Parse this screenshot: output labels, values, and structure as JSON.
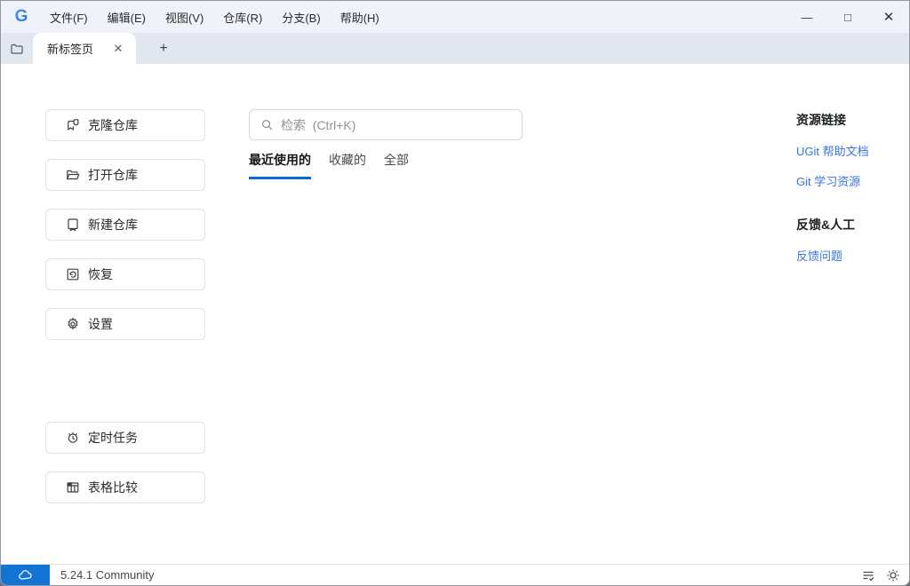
{
  "window": {
    "logo_text": "G",
    "menu_items": [
      {
        "label": "文件(F)"
      },
      {
        "label": "编辑(E)"
      },
      {
        "label": "视图(V)"
      },
      {
        "label": "仓库(R)"
      },
      {
        "label": "分支(B)"
      },
      {
        "label": "帮助(H)"
      }
    ],
    "controls": {
      "minimize": "—",
      "maximize": "□",
      "close": "✕"
    }
  },
  "tabbar": {
    "active_tab_label": "新标签页",
    "close_glyph": "✕",
    "new_tab_glyph": "+"
  },
  "sidebar": {
    "buttons": [
      {
        "label": "克隆仓库",
        "icon": "repo-clone-icon"
      },
      {
        "label": "打开仓库",
        "icon": "folder-open-icon"
      },
      {
        "label": "新建仓库",
        "icon": "repo-new-icon"
      },
      {
        "label": "恢复",
        "icon": "restore-icon"
      },
      {
        "label": "设置",
        "icon": "gear-icon"
      },
      {
        "label": "定时任务",
        "icon": "timer-task-icon"
      },
      {
        "label": "表格比较",
        "icon": "table-compare-icon"
      }
    ]
  },
  "main": {
    "search": {
      "placeholder": "检索  (Ctrl+K)"
    },
    "filter_tabs": [
      {
        "label": "最近使用的",
        "active": true
      },
      {
        "label": "收藏的",
        "active": false
      },
      {
        "label": "全部",
        "active": false
      }
    ]
  },
  "aside": {
    "sections": [
      {
        "title": "资源链接",
        "links": [
          {
            "label": "UGit 帮助文档"
          },
          {
            "label": "Git 学习资源"
          }
        ]
      },
      {
        "title": "反馈&人工",
        "links": [
          {
            "label": "反馈问题"
          }
        ]
      }
    ]
  },
  "statusbar": {
    "version": "5.24.1 Community"
  },
  "colors": {
    "accent": "#0969da",
    "link": "#3a73dd",
    "status-blue": "#1374d6",
    "titlebar-bg": "#eff2f8",
    "tabstrip-bg": "#e1e6ef"
  }
}
